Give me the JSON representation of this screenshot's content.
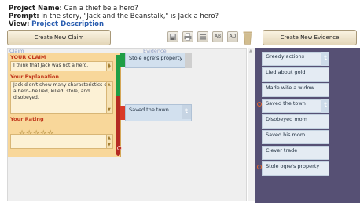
{
  "header": {
    "project_name_label": "Project Name:",
    "project_name": "Can a thief be a hero?",
    "prompt_label": "Prompt:",
    "prompt": "In the story, \"Jack and the Beanstalk,\" is Jack a hero?",
    "view_label": "View:",
    "view_link": "Project Description"
  },
  "toolbar": {
    "create_claim": "Create New Claim",
    "create_evidence": "Create New Evidence",
    "icons": [
      "save-icon",
      "print-icon",
      "align-icon",
      "text-ab-icon",
      "text-ad-icon",
      "trash-icon"
    ],
    "ab_text": "AB",
    "ad_text": "AD"
  },
  "canvas": {
    "claim_column_label": "Claim",
    "evidence_column_label": "Evidence",
    "claim": {
      "heading": "YOUR CLAIM",
      "text": "I think that Jack was not a hero.",
      "explanation_heading": "Your Explanation",
      "explanation": "Jack didn't show many characteristics of a hero--he lied, killed, stole, and disobeyed.",
      "rating_heading": "Your Rating",
      "stars": "☆☆☆☆☆",
      "rating_text": ""
    },
    "linked_evidence": [
      {
        "label": "Stole ogre's property",
        "tab": "",
        "color": "#1f9e45"
      },
      {
        "label": "Saved the town",
        "tab": "t",
        "color": "#d93a28"
      }
    ]
  },
  "evidence_list": [
    {
      "label": "Greedy actions",
      "tab": "t",
      "linked": false
    },
    {
      "label": "Lied about gold",
      "tab": "",
      "linked": false
    },
    {
      "label": "Made wife a widow",
      "tab": "",
      "linked": false
    },
    {
      "label": "Saved the town",
      "tab": "t",
      "linked": true
    },
    {
      "label": "Disobeyed mom",
      "tab": "",
      "linked": false
    },
    {
      "label": "Saved his mom",
      "tab": "",
      "linked": false
    },
    {
      "label": "Clever trade",
      "tab": "",
      "linked": false
    },
    {
      "label": "Stole ogre's property",
      "tab": "",
      "linked": true
    }
  ],
  "colors": {
    "evidence_panel": "#565074",
    "claim_panel": "#f8d79a",
    "claim_heading": "#c23a1e",
    "link_ring": "#e8682e"
  }
}
